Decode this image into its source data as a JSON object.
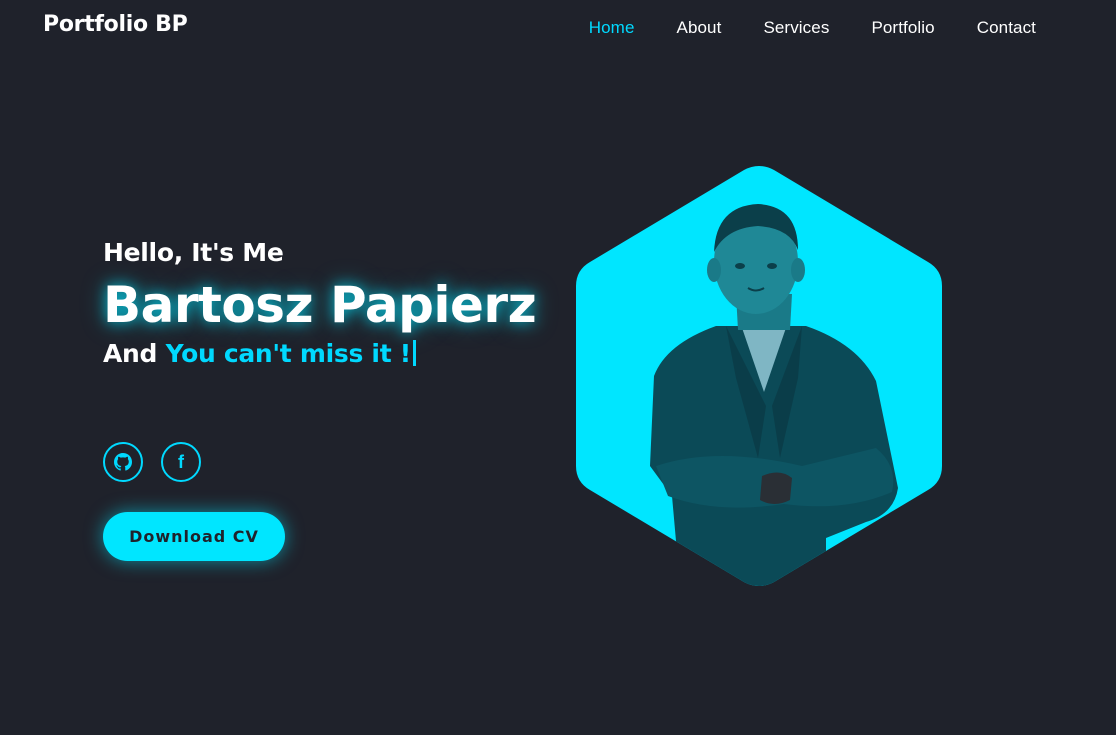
{
  "header": {
    "logo": "Portfolio BP",
    "nav": [
      {
        "label": "Home",
        "active": true
      },
      {
        "label": "About",
        "active": false
      },
      {
        "label": "Services",
        "active": false
      },
      {
        "label": "Portfolio",
        "active": false
      },
      {
        "label": "Contact",
        "active": false
      }
    ]
  },
  "hero": {
    "greeting": "Hello, It's Me",
    "name": "Bartosz Papierz",
    "tagline_prefix": "And",
    "tagline_accent": "You can't miss it !",
    "cv_label": "Download CV"
  },
  "socials": [
    {
      "icon": "github-icon"
    },
    {
      "icon": "facebook-icon",
      "glyph": "f"
    }
  ],
  "colors": {
    "background": "#1f222b",
    "accent": "#00d9ff",
    "text": "#ffffff"
  }
}
